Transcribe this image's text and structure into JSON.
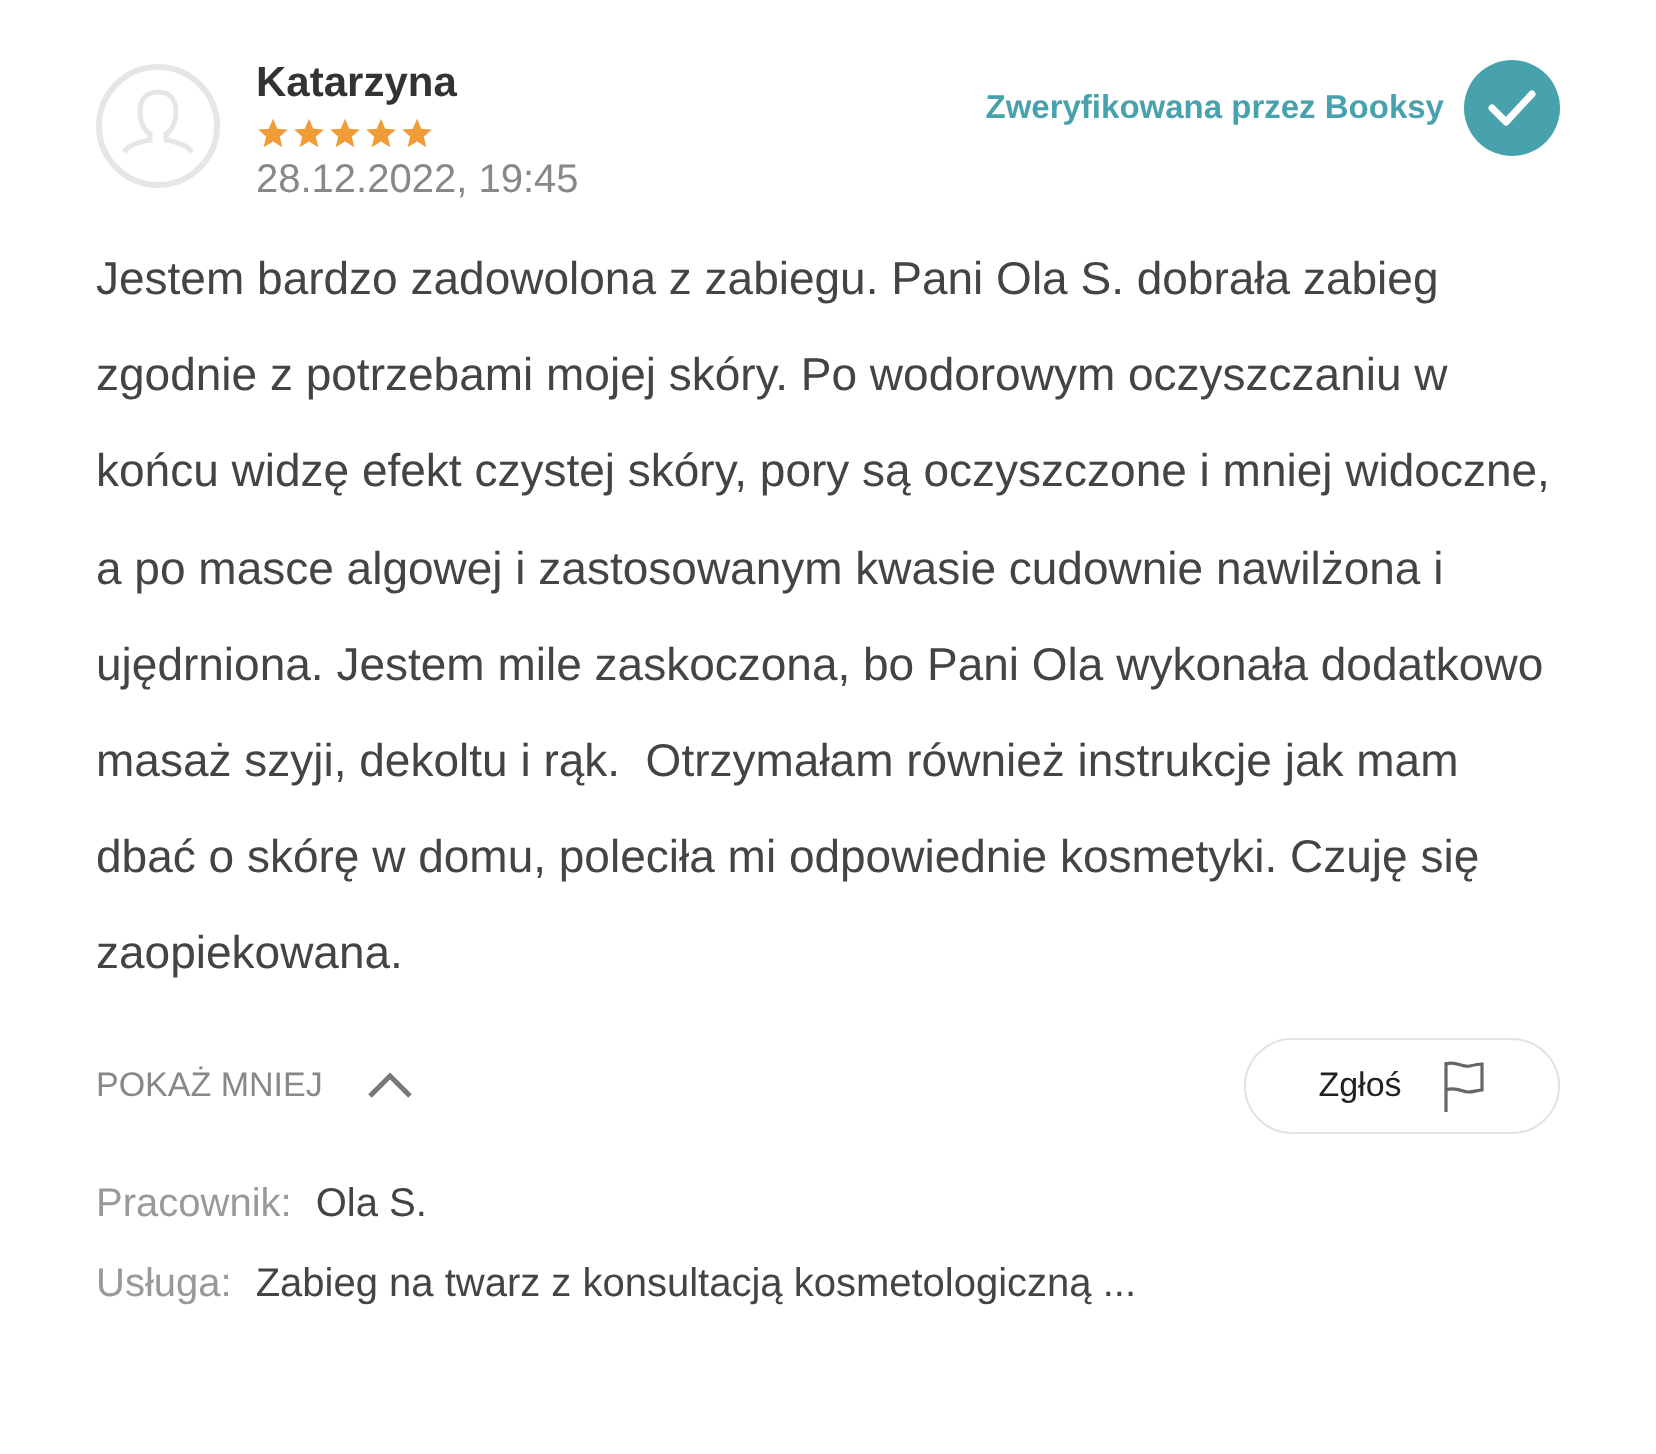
{
  "review": {
    "author": "Katarzyna",
    "stars": 5,
    "date": "28.12.2022, 19:45",
    "verified_label": "Zweryfikowana przez Booksy",
    "text": "Jestem bardzo zadowolona z zabiegu. Pani Ola S. dobrała zabieg zgodnie z potrzebami mojej skóry. Po wodorowym oczyszczaniu w końcu widzę efekt czystej skóry, pory są oczyszczone i mniej widoczne, a po masce algowej i zastosowanym kwasie cudownie nawilżona i ujędrniona. Jestem mile zaskoczona, bo Pani Ola wykonała dodatkowo masaż szyji, dekoltu i rąk.  Otrzymałam również instrukcje jak mam dbać o skórę w domu, poleciła mi odpowiednie kosmetyki. Czuję się zaopiekowana.",
    "toggle": {
      "label": "POKAŻ MNIEJ",
      "expanded": true
    },
    "report_button": "Zgłoś",
    "details": [
      {
        "label": "Pracownik:",
        "value": "Ola S."
      },
      {
        "label": "Usługa:",
        "value": "Zabieg na twarz  z konsultacją kosmetologiczną ..."
      }
    ]
  }
}
